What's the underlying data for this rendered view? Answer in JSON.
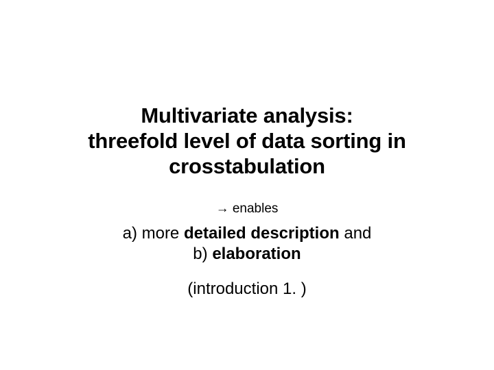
{
  "title": {
    "line1": "Multivariate analysis:",
    "line2": "threefold level of data sorting in",
    "line3": "crosstabulation"
  },
  "enables": "→ enables",
  "point_a": {
    "prefix": "a) more ",
    "bold": "detailed description",
    "suffix": " and"
  },
  "point_b": {
    "prefix": "b) ",
    "bold": "elaboration"
  },
  "intro": "(introduction 1. )"
}
